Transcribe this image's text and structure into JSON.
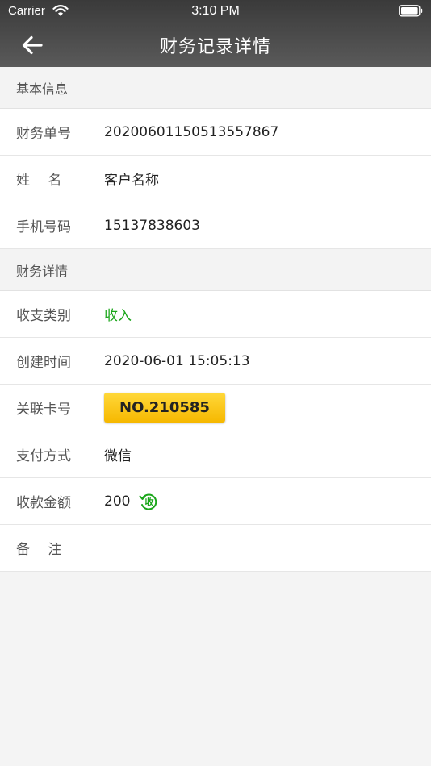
{
  "status_bar": {
    "carrier": "Carrier",
    "time": "3:10 PM"
  },
  "nav": {
    "title": "财务记录详情"
  },
  "sections": {
    "basic": {
      "title": "基本信息",
      "rows": [
        {
          "label": "财务单号",
          "value": "20200601150513557867"
        },
        {
          "label": "姓　 名",
          "value": "客户名称"
        },
        {
          "label": "手机号码",
          "value": "15137838603"
        }
      ]
    },
    "detail": {
      "title": "财务详情",
      "type_label": "收支类别",
      "type_value": "收入",
      "created_label": "创建时间",
      "created_value": "2020-06-01 15:05:13",
      "card_label": "关联卡号",
      "card_value": "NO.210585",
      "payment_label": "支付方式",
      "payment_value": "微信",
      "amount_label": "收款金额",
      "amount_value": "200",
      "amount_icon_text": "收",
      "note_label": "备　 注",
      "note_value": ""
    }
  },
  "colors": {
    "income_green": "#1aa61a",
    "badge_yellow": "#f6b800"
  }
}
